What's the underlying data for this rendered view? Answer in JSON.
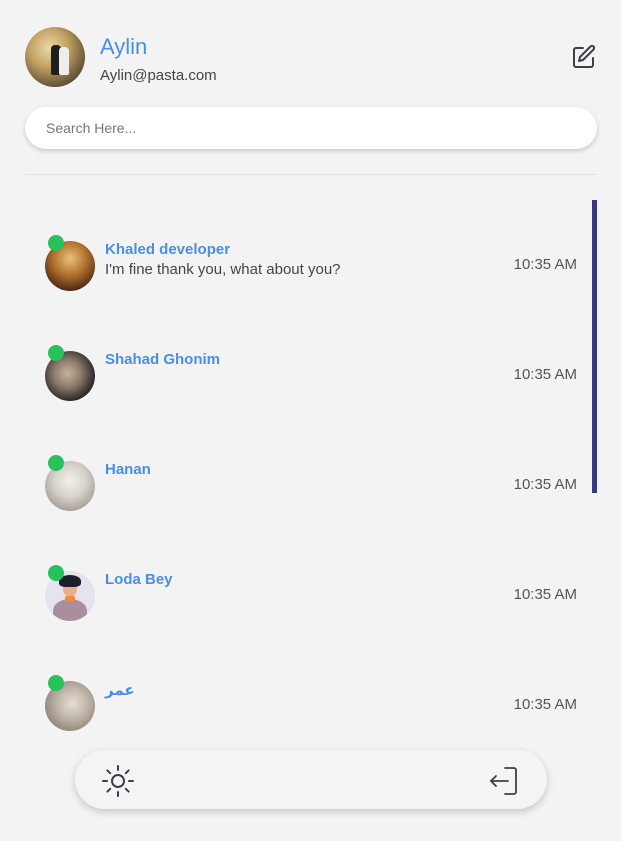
{
  "profile": {
    "name": "Aylin",
    "email": "Aylin@pasta.com",
    "avatar_icon": "profile-photo",
    "edit_icon": "edit-icon"
  },
  "search": {
    "placeholder": "Search Here...",
    "value": ""
  },
  "chats": [
    {
      "name": "Khaled developer",
      "message": "I'm fine thank you, what about you?",
      "time": "10:35 AM",
      "online": true
    },
    {
      "name": "Shahad Ghonim",
      "message": "",
      "time": "10:35 AM",
      "online": true
    },
    {
      "name": "Hanan",
      "message": "",
      "time": "10:35 AM",
      "online": true
    },
    {
      "name": "Loda Bey",
      "message": "",
      "time": "10:35 AM",
      "online": true
    },
    {
      "name": "عمر",
      "message": "",
      "time": "10:35 AM",
      "online": true
    }
  ],
  "bottom_bar": {
    "theme_icon": "sun-icon",
    "logout_icon": "logout-icon"
  },
  "colors": {
    "accent": "#4a8fe6",
    "online": "#27c25a",
    "scrollbar": "#343980",
    "background": "#f3f3f4"
  }
}
